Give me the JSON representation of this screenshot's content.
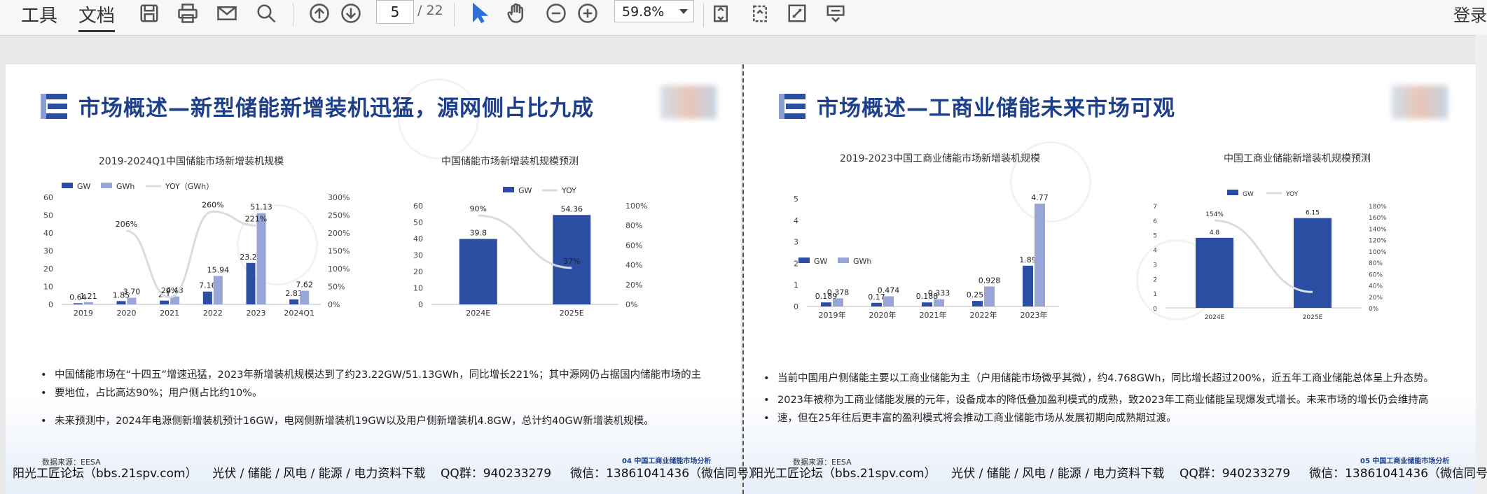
{
  "toolbar": {
    "menu_tools": "工具",
    "menu_document": "文档",
    "page_current": "5",
    "page_total": "/ 22",
    "zoom": "59.8%",
    "login": "登录",
    "icons": [
      "save-icon",
      "print-icon",
      "mail-icon",
      "search-icon",
      "page-up-icon",
      "page-down-icon",
      "select-cursor-icon",
      "hand-tool-icon",
      "zoom-out-icon",
      "zoom-in-icon",
      "fit-page-icon",
      "rotate-icon",
      "fullscreen-icon",
      "more-icon"
    ]
  },
  "left_slide": {
    "title": "市场概述—新型储能新增装机迅猛，源网侧占比九成",
    "chart1_title": "2019-2024Q1中国储能市场新增装机规模",
    "chart2_title": "中国储能市场新增装机规模预测",
    "bullets": [
      "中国储能市场在“十四五”增速迅猛，2023年新增装机规模达到了约23.22GW/51.13GWh，同比增长221%；其中源网仍占据国内储能市场的主",
      "要地位，占比高达90%；用户侧占比约10%。",
      "未来预测中，2024年电源侧新增装机预计16GW，电网侧新增装机19GW以及用户侧新增装机4.8GW，总计约40GW新增装机规模。"
    ],
    "source": "数据来源：EESA",
    "page_tag": "04 中国工商业储能市场分析"
  },
  "right_slide": {
    "title": "市场概述—工商业储能未来市场可观",
    "chart1_title": "2019-2023中国工商业储能市场新增装机规模",
    "chart2_title": "中国工商业储能新增装机规模预测",
    "bullets": [
      "当前中国用户侧储能主要以工商业储能为主（户用储能市场微乎其微），约4.768GWh，同比增长超过200%，近五年工商业储能总体呈上升态势。",
      "2023年被称为工商业储能发展的元年，设备成本的降低叠加盈利模式的成熟，致2023年工商业储能呈现爆发式增长。未来市场的增长仍会维持高",
      "速，但在25年往后更丰富的盈利模式将会推动工商业储能市场从发展初期向成熟期过渡。"
    ],
    "source": "数据来源：EESA",
    "page_tag": "05 中国工商业储能市场分析"
  },
  "footer": {
    "left": "阳光工匠论坛（bbs.21spv.com）    光伏 / 储能 / 风电 / 能源 / 电力资料下载    QQ群：940233279     微信：13861041436（微信同号）",
    "right": "阳光工匠论坛（bbs.21spv.com）    光伏 / 储能 / 风电 / 能源 / 电力资料下载    QQ群：940233279     微信：13861041436（微信同号）"
  },
  "chart_data": [
    {
      "type": "bar",
      "title": "2019-2024Q1中国储能市场新增装机规模",
      "categories": [
        "2019",
        "2020",
        "2021",
        "2022",
        "2023",
        "2024Q1"
      ],
      "series": [
        {
          "name": "GW",
          "values": [
            0.64,
            1.85,
            2.1,
            7.16,
            23.22,
            2.81
          ]
        },
        {
          "name": "GWh",
          "values": [
            1.21,
            3.7,
            4.43,
            15.94,
            51.13,
            7.62
          ]
        },
        {
          "name": "YOY（GWh）",
          "values": [
            null,
            206,
            20,
            260,
            221,
            null
          ],
          "labels": [
            "",
            "206%",
            "20%",
            "260%",
            "221%",
            ""
          ]
        }
      ],
      "value_labels": {
        "GW": [
          "0.64",
          "1.85",
          "2.1",
          "7.16",
          "23.22",
          "2.81"
        ],
        "GWh": [
          "1.21",
          "3.70",
          "4.43",
          "15.94",
          "51.13",
          "7.62"
        ]
      },
      "ylim": [
        0,
        60
      ],
      "y2lim": [
        0,
        300
      ],
      "yticks": [
        "0",
        "10",
        "20",
        "30",
        "40",
        "50",
        "60"
      ],
      "y2ticks": [
        "0%",
        "50%",
        "100%",
        "150%",
        "200%",
        "250%",
        "300%"
      ]
    },
    {
      "type": "bar",
      "title": "中国储能市场新增装机规模预测",
      "categories": [
        "2024E",
        "2025E"
      ],
      "series": [
        {
          "name": "GW",
          "values": [
            39.8,
            54.36
          ]
        },
        {
          "name": "YOY",
          "values": [
            90,
            37
          ],
          "labels": [
            "90%",
            "37%"
          ]
        }
      ],
      "value_labels": {
        "GW": [
          "39.8",
          "54.36"
        ]
      },
      "ylim": [
        0,
        60
      ],
      "y2lim": [
        0,
        100
      ],
      "yticks": [
        "0",
        "10",
        "20",
        "30",
        "40",
        "50",
        "60"
      ],
      "y2ticks": [
        "0%",
        "20%",
        "40%",
        "60%",
        "80%",
        "100%"
      ]
    },
    {
      "type": "bar",
      "title": "2019-2023中国工商业储能市场新增装机规模",
      "categories": [
        "2019年",
        "2020年",
        "2021年",
        "2022年",
        "2023年"
      ],
      "series": [
        {
          "name": "GW",
          "values": [
            0.189,
            0.17,
            0.188,
            0.257,
            1.89
          ]
        },
        {
          "name": "GWh",
          "values": [
            0.378,
            0.474,
            0.333,
            0.928,
            4.77
          ]
        }
      ],
      "value_labels": {
        "GW": [
          "0.189",
          "0.17",
          "0.188",
          "0.257",
          "1.89"
        ],
        "GWh": [
          "0.378",
          "0.474",
          "0.333",
          "0.928",
          "4.77"
        ]
      },
      "ylim": [
        0,
        5
      ],
      "yticks": [
        "0",
        "1",
        "2",
        "3",
        "4",
        "5"
      ]
    },
    {
      "type": "bar",
      "title": "中国工商业储能新增装机规模预测",
      "categories": [
        "2024E",
        "2025E"
      ],
      "series": [
        {
          "name": "GW",
          "values": [
            4.8,
            6.15
          ]
        },
        {
          "name": "YOY",
          "values": [
            154,
            28
          ],
          "labels": [
            "154%",
            ""
          ]
        }
      ],
      "value_labels": {
        "GW": [
          "4.8",
          "6.15"
        ]
      },
      "ylim": [
        0,
        7
      ],
      "y2lim": [
        0,
        180
      ],
      "yticks": [
        "0",
        "1",
        "2",
        "3",
        "4",
        "5",
        "6",
        "7"
      ],
      "y2ticks": [
        "0%",
        "20%",
        "40%",
        "60%",
        "80%",
        "100%",
        "120%",
        "140%",
        "160%",
        "180%"
      ]
    }
  ],
  "colors": {
    "dark_blue": "#2b4ea2",
    "light_blue": "#97a6d6",
    "title_blue": "#1e3f8a",
    "yoy_line": "#d9dce4"
  }
}
